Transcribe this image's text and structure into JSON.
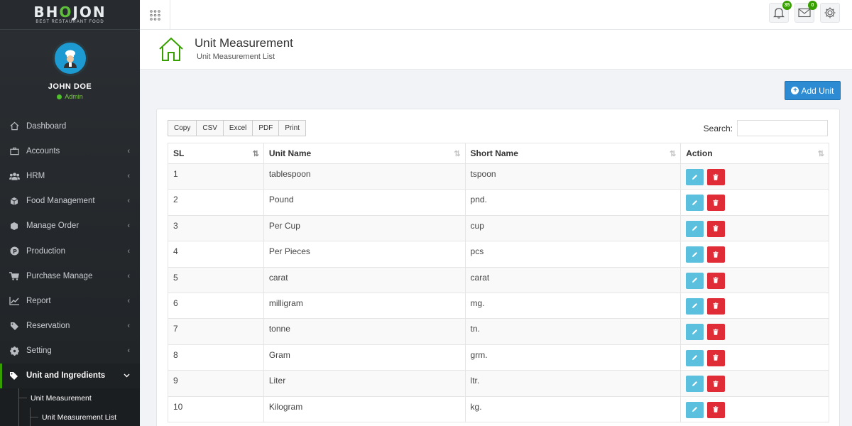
{
  "brand": {
    "name_pre": "BH",
    "name_o": "O",
    "name_post": "JON",
    "tagline": "BEST RESTAURANT FOOD"
  },
  "profile": {
    "name": "JOHN DOE",
    "role": "Admin"
  },
  "sidebar": {
    "items": [
      {
        "label": "Dashboard",
        "icon": "home-icon",
        "caret": ""
      },
      {
        "label": "Accounts",
        "icon": "briefcase-icon",
        "caret": "‹"
      },
      {
        "label": "HRM",
        "icon": "users-icon",
        "caret": "‹"
      },
      {
        "label": "Food Management",
        "icon": "cube-icon",
        "caret": "‹"
      },
      {
        "label": "Manage Order",
        "icon": "cubes-icon",
        "caret": "‹"
      },
      {
        "label": "Production",
        "icon": "production-icon",
        "caret": "‹"
      },
      {
        "label": "Purchase Manage",
        "icon": "cart-icon",
        "caret": "‹"
      },
      {
        "label": "Report",
        "icon": "chart-icon",
        "caret": "‹"
      },
      {
        "label": "Reservation",
        "icon": "tag-icon",
        "caret": "‹"
      },
      {
        "label": "Setting",
        "icon": "gear-icon",
        "caret": "‹"
      },
      {
        "label": "Unit and Ingredients",
        "icon": "tags-icon",
        "caret": "⌄"
      }
    ],
    "submenu": {
      "parent": "Unit Measurement",
      "child": "Unit Measurement List"
    }
  },
  "topbar": {
    "notifications_count": "35",
    "messages_count": "0"
  },
  "header": {
    "title": "Unit Measurement",
    "subtitle": "Unit Measurement List"
  },
  "add_button": {
    "label": "Add Unit"
  },
  "toolbar": {
    "buttons": [
      "Copy",
      "CSV",
      "Excel",
      "PDF",
      "Print"
    ],
    "search_label": "Search:",
    "search_value": ""
  },
  "table": {
    "columns": [
      "SL",
      "Unit Name",
      "Short Name",
      "Action"
    ],
    "rows": [
      {
        "sl": "1",
        "unit": "tablespoon",
        "short": "tspoon"
      },
      {
        "sl": "2",
        "unit": "Pound",
        "short": "pnd."
      },
      {
        "sl": "3",
        "unit": "Per Cup",
        "short": "cup"
      },
      {
        "sl": "4",
        "unit": "Per Pieces",
        "short": "pcs"
      },
      {
        "sl": "5",
        "unit": "carat",
        "short": "carat"
      },
      {
        "sl": "6",
        "unit": "milligram",
        "short": "mg."
      },
      {
        "sl": "7",
        "unit": "tonne",
        "short": "tn."
      },
      {
        "sl": "8",
        "unit": "Gram",
        "short": "grm."
      },
      {
        "sl": "9",
        "unit": "Liter",
        "short": "ltr."
      },
      {
        "sl": "10",
        "unit": "Kilogram",
        "short": "kg."
      }
    ]
  },
  "colors": {
    "accent": "#37a000",
    "primary_button": "#2c8bd2",
    "edit_button": "#5bc0de",
    "delete_button": "#e02c36",
    "sidebar_bg": "#2b2f33"
  }
}
